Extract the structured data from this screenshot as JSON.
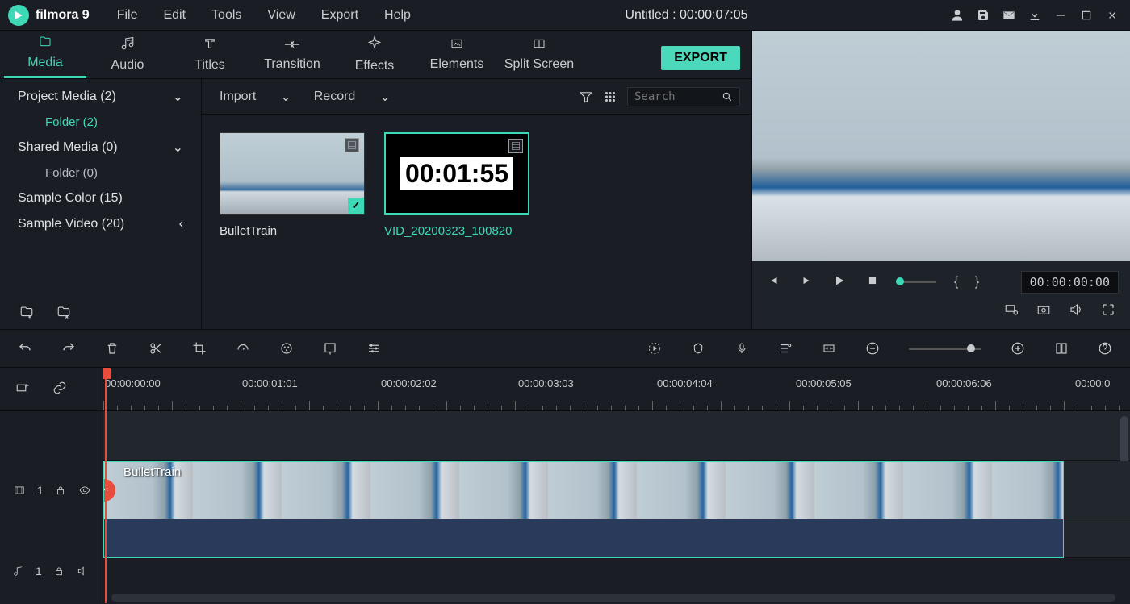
{
  "brand": "filmora 9",
  "menu": [
    "File",
    "Edit",
    "Tools",
    "View",
    "Export",
    "Help"
  ],
  "title": "Untitled : 00:00:07:05",
  "tabs": [
    {
      "label": "Media",
      "icon": "folder-icon"
    },
    {
      "label": "Audio",
      "icon": "music-icon"
    },
    {
      "label": "Titles",
      "icon": "text-icon"
    },
    {
      "label": "Transition",
      "icon": "transition-icon"
    },
    {
      "label": "Effects",
      "icon": "sparkle-icon"
    },
    {
      "label": "Elements",
      "icon": "image-icon"
    },
    {
      "label": "Split Screen",
      "icon": "split-icon"
    }
  ],
  "active_tab": 0,
  "export_label": "EXPORT",
  "tree": {
    "project_media": "Project Media (2)",
    "project_folder": "Folder (2)",
    "shared_media": "Shared Media (0)",
    "shared_folder": "Folder (0)",
    "sample_color": "Sample Color (15)",
    "sample_video": "Sample Video (20)"
  },
  "import_label": "Import",
  "record_label": "Record",
  "search_placeholder": "Search",
  "clips": [
    {
      "name": "BulletTrain",
      "used": true,
      "selected": false
    },
    {
      "name": "VID_20200323_100820",
      "used": false,
      "selected": true,
      "timer": "00:01:55"
    }
  ],
  "preview": {
    "timecode": "00:00:00:00",
    "braces": "{  }"
  },
  "ruler_marks": [
    {
      "label": "00:00:00:00",
      "pos": 2
    },
    {
      "label": "00:00:01:01",
      "pos": 172
    },
    {
      "label": "00:00:02:02",
      "pos": 344
    },
    {
      "label": "00:00:03:03",
      "pos": 514
    },
    {
      "label": "00:00:04:04",
      "pos": 686
    },
    {
      "label": "00:00:05:05",
      "pos": 858
    },
    {
      "label": "00:00:06:06",
      "pos": 1032
    },
    {
      "label": "00:00:0",
      "pos": 1204
    }
  ],
  "timeline_clip_label": "BulletTrain",
  "track_video_num": "1",
  "track_audio_num": "1"
}
